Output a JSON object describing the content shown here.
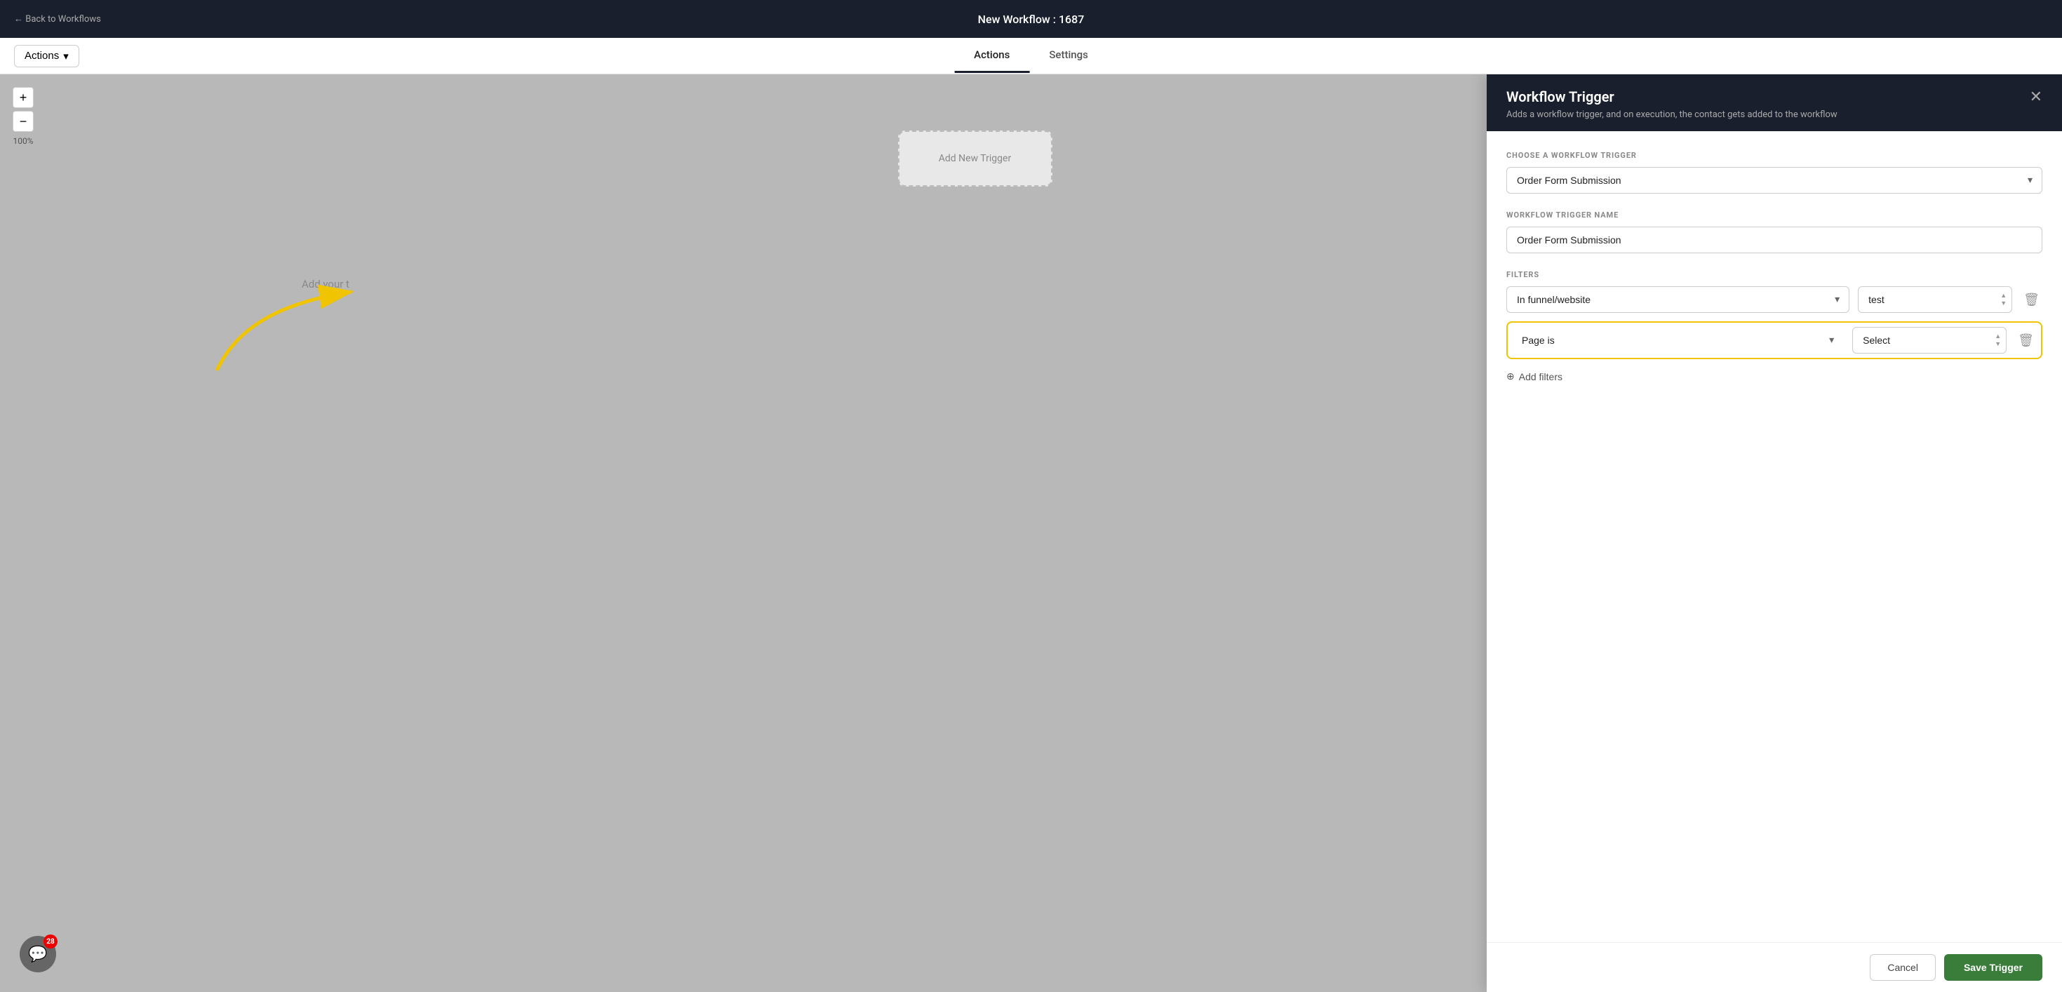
{
  "topNav": {
    "backLabel": "← Back to Workflows",
    "workflowTitle": "New Workflow : 1687"
  },
  "toolbar": {
    "actionsLabel": "Actions",
    "actionsChevron": "▾",
    "tabs": [
      {
        "id": "actions",
        "label": "Actions",
        "active": true
      },
      {
        "id": "settings",
        "label": "Settings",
        "active": false
      }
    ]
  },
  "canvas": {
    "zoomIn": "+",
    "zoomOut": "−",
    "zoomLevel": "100%",
    "triggerCardText": "Add New Trigger",
    "addYourText": "Add your t"
  },
  "panel": {
    "title": "Workflow Trigger",
    "subtitle": "Adds a workflow trigger, and on execution, the contact gets added to the workflow",
    "closeIcon": "✕",
    "chooseTriggerLabel": "CHOOSE A WORKFLOW TRIGGER",
    "chooseTriggerValue": "Order Form Submission",
    "triggerNameLabel": "WORKFLOW TRIGGER NAME",
    "triggerNameValue": "Order Form Submission",
    "filtersLabel": "FILTERS",
    "filters": [
      {
        "id": "filter1",
        "filterType": "In funnel/website",
        "value": "test",
        "highlighted": false
      },
      {
        "id": "filter2",
        "filterType": "Page is",
        "value": "Select",
        "highlighted": true
      }
    ],
    "addFiltersLabel": "Add filters",
    "footer": {
      "cancelLabel": "Cancel",
      "saveLabel": "Save Trigger"
    }
  },
  "chatWidget": {
    "badge": "28",
    "icon": "💬"
  }
}
